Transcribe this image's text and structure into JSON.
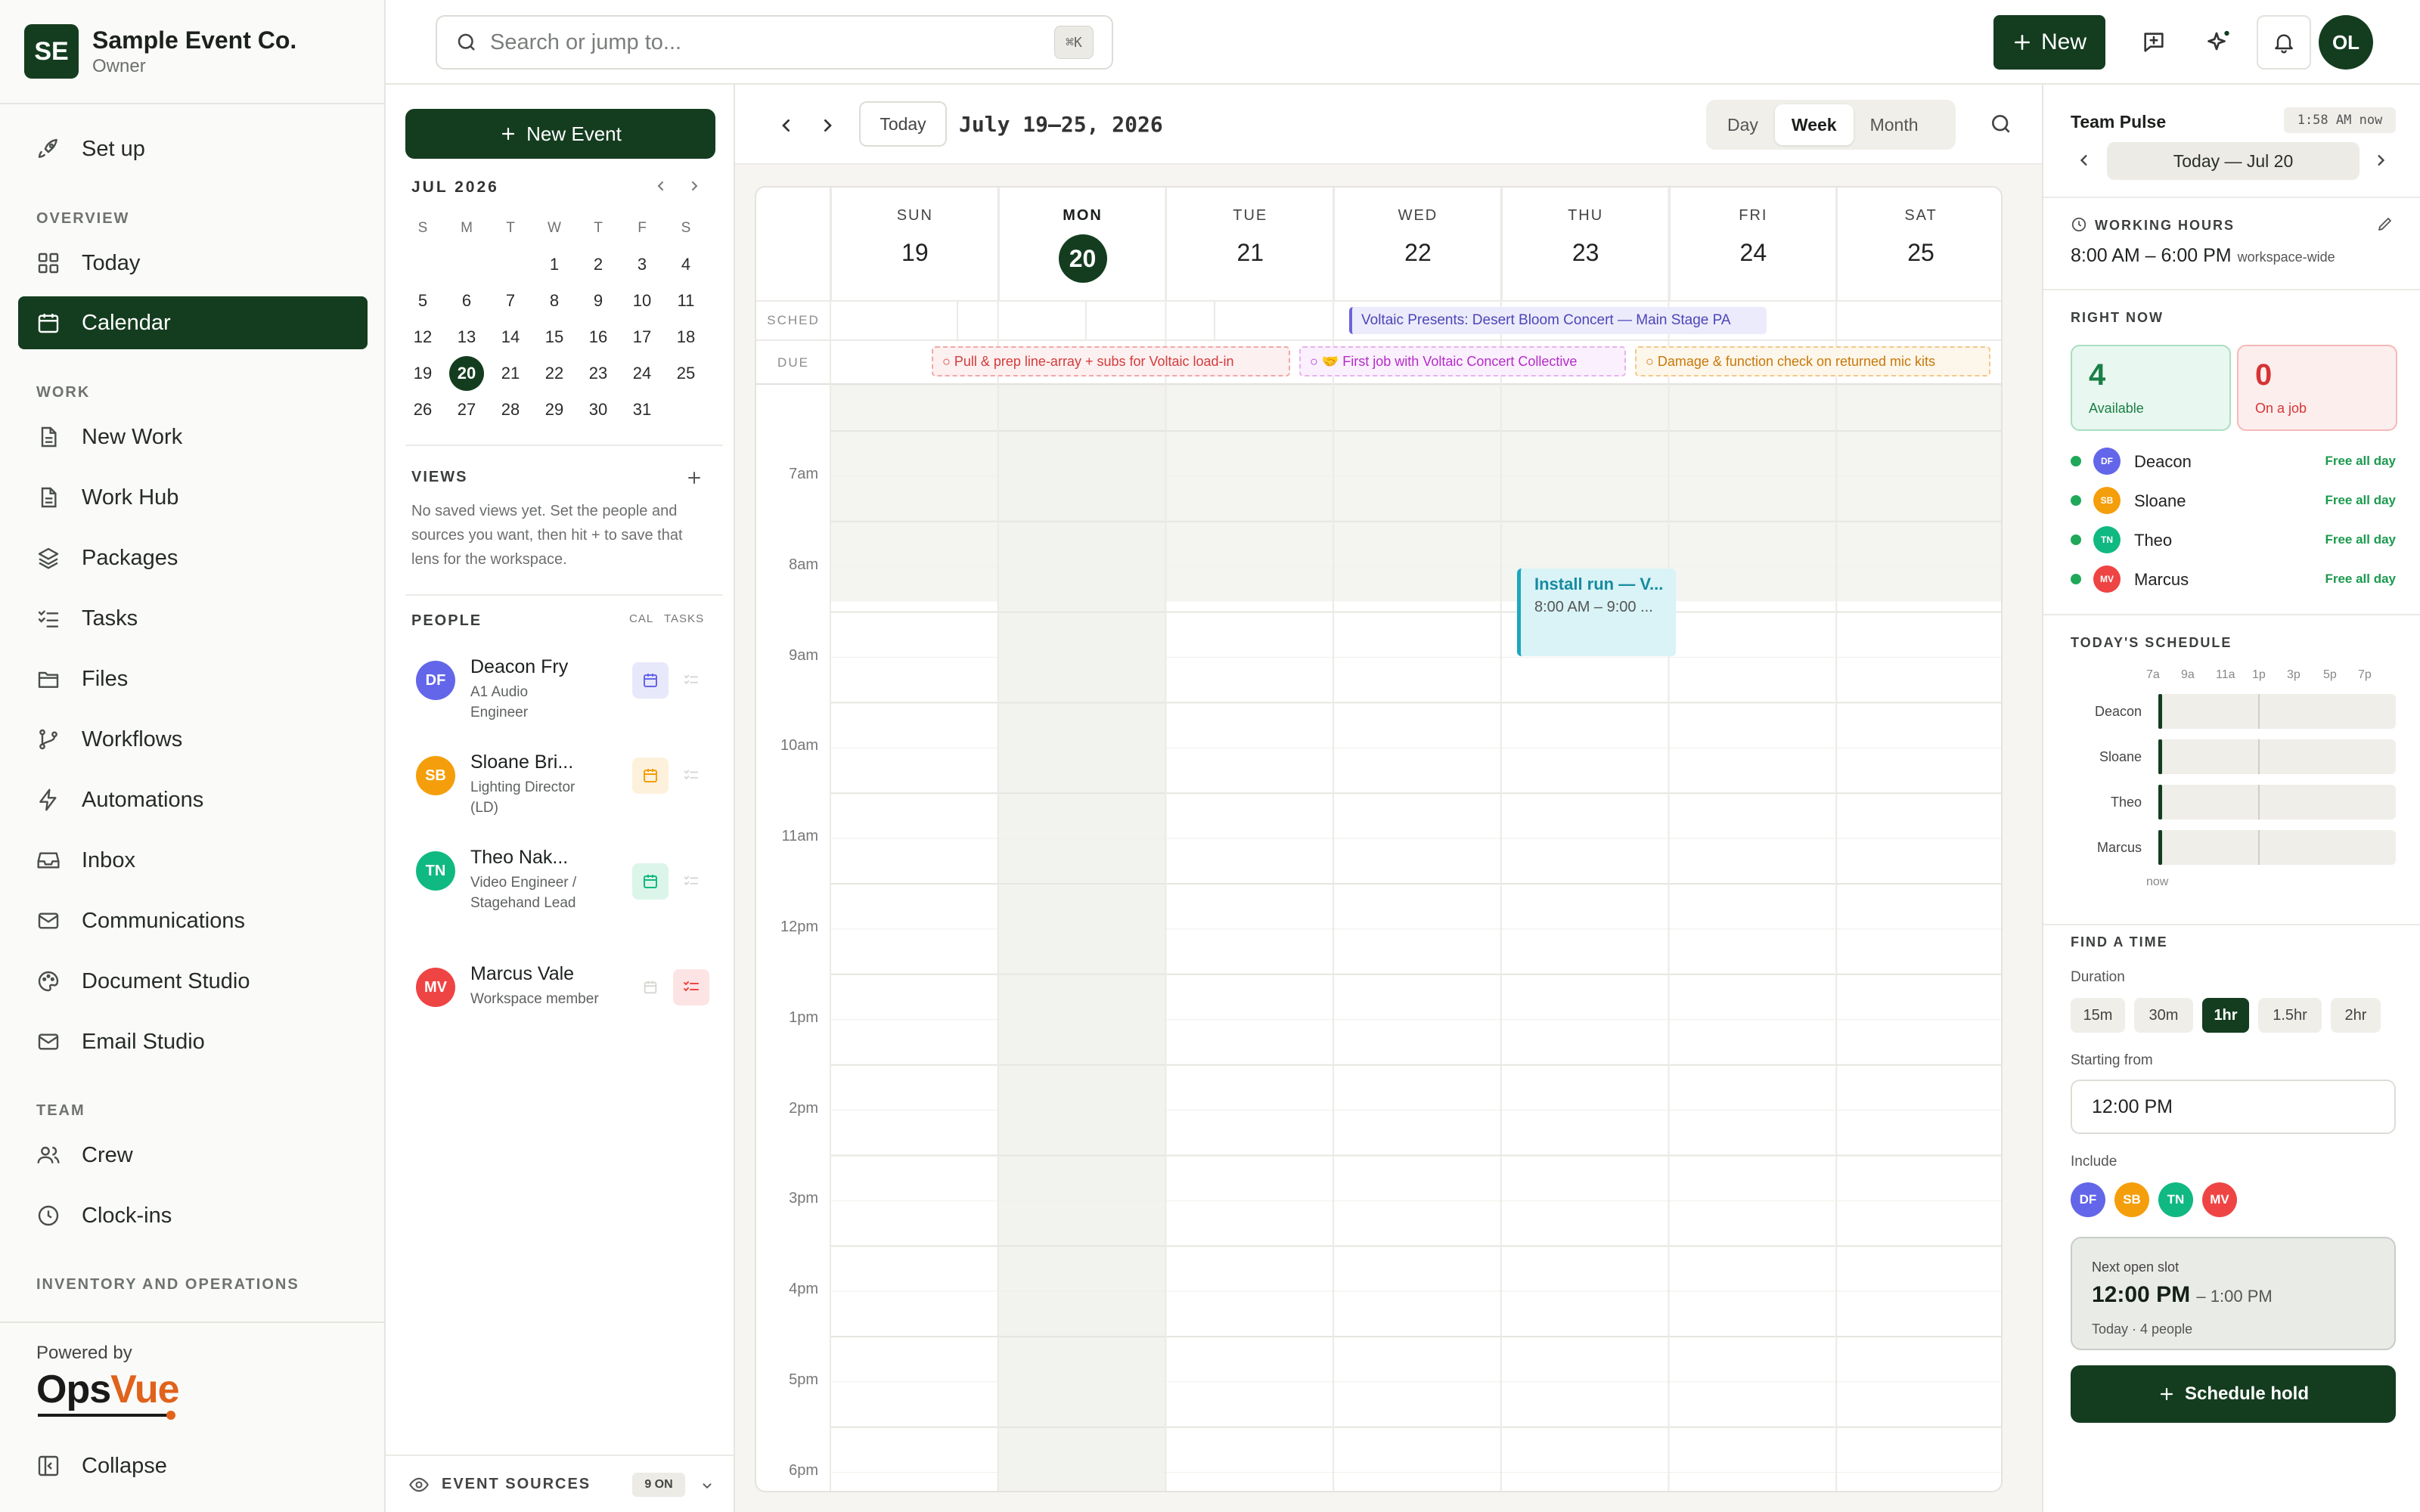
{
  "brand": {
    "initials": "SE",
    "name": "Sample Event Co.",
    "role": "Owner"
  },
  "sidebar": {
    "setup": "Set up",
    "sections": {
      "overview": "OVERVIEW",
      "work": "WORK",
      "team": "TEAM",
      "inventory": "INVENTORY AND OPERATIONS"
    },
    "overview": [
      {
        "label": "Today",
        "icon": "grid-icon"
      },
      {
        "label": "Calendar",
        "icon": "calendar-icon",
        "active": true
      }
    ],
    "work": [
      {
        "label": "New Work",
        "icon": "document-icon"
      },
      {
        "label": "Work Hub",
        "icon": "document-icon"
      },
      {
        "label": "Packages",
        "icon": "layers-icon"
      },
      {
        "label": "Tasks",
        "icon": "checklist-icon"
      },
      {
        "label": "Files",
        "icon": "folder-icon"
      },
      {
        "label": "Workflows",
        "icon": "branch-icon"
      },
      {
        "label": "Automations",
        "icon": "bolt-icon"
      },
      {
        "label": "Inbox",
        "icon": "inbox-icon"
      },
      {
        "label": "Communications",
        "icon": "mail-icon"
      },
      {
        "label": "Document Studio",
        "icon": "palette-icon"
      },
      {
        "label": "Email Studio",
        "icon": "mail-icon"
      }
    ],
    "team": [
      {
        "label": "Crew",
        "icon": "users-icon"
      },
      {
        "label": "Clock-ins",
        "icon": "clock-icon"
      }
    ],
    "powered_by": "Powered by",
    "logo_ops": "Ops",
    "logo_vue": "Vue",
    "collapse": "Collapse"
  },
  "topbar": {
    "search_placeholder": "Search or jump to...",
    "shortcut": "⌘K",
    "new_label": "New",
    "user_initials": "OL"
  },
  "mini_calendar": {
    "title": "JUL 2026",
    "dow": [
      "S",
      "M",
      "T",
      "W",
      "T",
      "F",
      "S"
    ],
    "weeks": [
      [
        "",
        "",
        "",
        "1",
        "2",
        "3",
        "4"
      ],
      [
        "5",
        "6",
        "7",
        "8",
        "9",
        "10",
        "11"
      ],
      [
        "12",
        "13",
        "14",
        "15",
        "16",
        "17",
        "18"
      ],
      [
        "19",
        "20",
        "21",
        "22",
        "23",
        "24",
        "25"
      ],
      [
        "26",
        "27",
        "28",
        "29",
        "30",
        "31",
        ""
      ]
    ],
    "today": "20"
  },
  "left_panel": {
    "new_event": "New Event",
    "views_title": "VIEWS",
    "views_empty": "No saved views yet. Set the people and sources you want, then hit + to save that lens for the workspace.",
    "people_title": "PEOPLE",
    "col_cal": "CAL",
    "col_tasks": "TASKS",
    "people": [
      {
        "initials": "DF",
        "name": "Deacon Fry",
        "role": "A1 Audio Engineer",
        "color": "#6366e8"
      },
      {
        "initials": "SB",
        "name": "Sloane Bri...",
        "role": "Lighting Director (LD)",
        "color": "#f59e0b"
      },
      {
        "initials": "TN",
        "name": "Theo Nak...",
        "role": "Video Engineer / Stagehand Lead",
        "color": "#10b981"
      },
      {
        "initials": "MV",
        "name": "Marcus Vale",
        "role": "Workspace member",
        "color": "#ef4444"
      }
    ],
    "event_sources": "EVENT SOURCES",
    "event_sources_count": "9 ON"
  },
  "calendar": {
    "today_button": "Today",
    "range": "July 19–25, 2026",
    "views": [
      "Day",
      "Week",
      "Month"
    ],
    "active_view": "Week",
    "days": [
      {
        "dow": "SUN",
        "date": "19"
      },
      {
        "dow": "MON",
        "date": "20",
        "today": true
      },
      {
        "dow": "TUE",
        "date": "21"
      },
      {
        "dow": "WED",
        "date": "22"
      },
      {
        "dow": "THU",
        "date": "23"
      },
      {
        "dow": "FRI",
        "date": "24"
      },
      {
        "dow": "SAT",
        "date": "25"
      }
    ],
    "row_sched": "SCHED",
    "row_due": "DUE",
    "sched_event": "Voltaic Presents: Desert Bloom Concert — Main Stage PA",
    "due_items": [
      {
        "text": "○ Pull & prep line-array + subs for Voltaic load-in",
        "color": "#dc3b3b"
      },
      {
        "text": "○ 🤝 First job with Voltaic Concert Collective",
        "color": "#c026d3"
      },
      {
        "text": "○ Damage & function check on returned mic kits",
        "color": "#d97706"
      }
    ],
    "hours": [
      "7am",
      "8am",
      "9am",
      "10am",
      "11am",
      "12pm",
      "1pm",
      "2pm",
      "3pm",
      "4pm",
      "5pm",
      "6pm"
    ],
    "event": {
      "title": "Install run — V...",
      "time": "8:00 AM – 9:00 ..."
    }
  },
  "right_panel": {
    "title": "Team Pulse",
    "time": "1:58 AM now",
    "date_label": "Today — Jul 20",
    "working_hours_title": "WORKING HOURS",
    "working_hours": "8:00 AM – 6:00 PM",
    "working_hours_scope": "workspace-wide",
    "right_now_title": "RIGHT NOW",
    "available": "4",
    "available_label": "Available",
    "on_job": "0",
    "on_job_label": "On a job",
    "crew": [
      {
        "initials": "DF",
        "name": "Deacon",
        "status": "Free all day",
        "color": "#6366e8"
      },
      {
        "initials": "SB",
        "name": "Sloane",
        "status": "Free all day",
        "color": "#f59e0b"
      },
      {
        "initials": "TN",
        "name": "Theo",
        "status": "Free all day",
        "color": "#10b981"
      },
      {
        "initials": "MV",
        "name": "Marcus",
        "status": "Free all day",
        "color": "#ef4444"
      }
    ],
    "schedule_title": "TODAY'S SCHEDULE",
    "schedule_ticks": [
      "7a",
      "9a",
      "11a",
      "1p",
      "3p",
      "5p",
      "7p"
    ],
    "schedule_now": "now",
    "find_time_title": "FIND A TIME",
    "duration_label": "Duration",
    "durations": [
      "15m",
      "30m",
      "1hr",
      "1.5hr",
      "2hr"
    ],
    "active_duration": "1hr",
    "starting_from_label": "Starting from",
    "starting_from": "12:00 PM",
    "include_label": "Include",
    "next_slot_label": "Next open slot",
    "next_slot_start": "12:00 PM",
    "next_slot_end": "– 1:00 PM",
    "next_slot_meta": "Today · 4 people",
    "schedule_hold": "Schedule hold"
  }
}
